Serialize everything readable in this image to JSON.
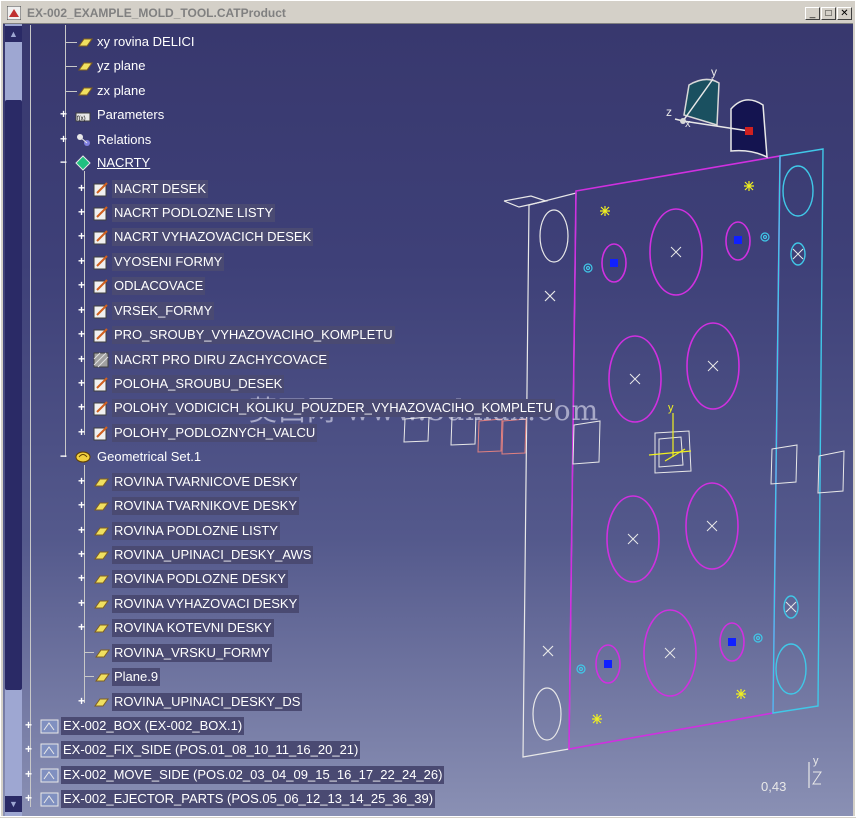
{
  "window": {
    "title": "EX-002_EXAMPLE_MOLD_TOOL.CATProduct",
    "min_glyph": "_",
    "max_glyph": "□",
    "close_glyph": "✕"
  },
  "tree": {
    "planes_top": [
      "xy rovina DELICI",
      "yz plane",
      "zx plane"
    ],
    "parameters": "Parameters",
    "relations": "Relations",
    "nacrty": "NACRTY",
    "sketches": [
      "NACRT DESEK",
      "NACRT PODLOZNE LISTY",
      "NACRT VYHAZOVACICH DESEK",
      "VYOSENI FORMY",
      "ODLACOVACE",
      "VRSEK_FORMY",
      "PRO_SROUBY_VYHAZOVACIHO_KOMPLETU",
      "NACRT PRO DIRU ZACHYCOVACE",
      "POLOHA_SROUBU_DESEK",
      "POLOHY_VODICICH_KOLIKU_POUZDER_VYHAZOVACIHO_KOMPLETU",
      "POLOHY_PODLOZNYCH_VALCU"
    ],
    "geoset": "Geometrical Set.1",
    "geo_planes": [
      "ROVINA TVARNICOVE DESKY",
      "ROVINA TVARNIKOVE DESKY",
      "ROVINA PODLOZNE LISTY",
      "ROVINA_UPINACI_DESKY_AWS",
      "ROVINA PODLOZNE DESKY",
      "ROVINA VYHAZOVACI DESKY",
      "ROVINA KOTEVNI DESKY",
      "ROVINA_VRSKU_FORMY",
      "Plane.9",
      "ROVINA_UPINACI_DESKY_DS"
    ],
    "products": [
      "EX-002_BOX (EX-002_BOX.1)",
      "EX-002_FIX_SIDE (POS.01_08_10_11_16_20_21)",
      "EX-002_MOVE_SIDE (POS.02_03_04_09_15_16_17_22_24_26)",
      "EX-002_EJECTOR_PARTS (POS.05_06_12_13_14_25_36_39)"
    ]
  },
  "compass": {
    "x_label": "x",
    "y_label": "y",
    "z_label": "z"
  },
  "axis_triad": {
    "y_label": "y",
    "z_label": "z"
  },
  "model_axis_label": "y",
  "zoom_level": "0,43",
  "watermark": "莫西网 www.3dmax.com",
  "colors": {
    "viewport_top": "#38386e",
    "viewport_bottom": "#8a90b4",
    "plate_magenta": "#d030e0",
    "plate_cyan": "#40c8e8",
    "plate_white": "#e8e8e8",
    "marker_blue": "#1020ff",
    "marker_yellow": "#f0f020"
  }
}
